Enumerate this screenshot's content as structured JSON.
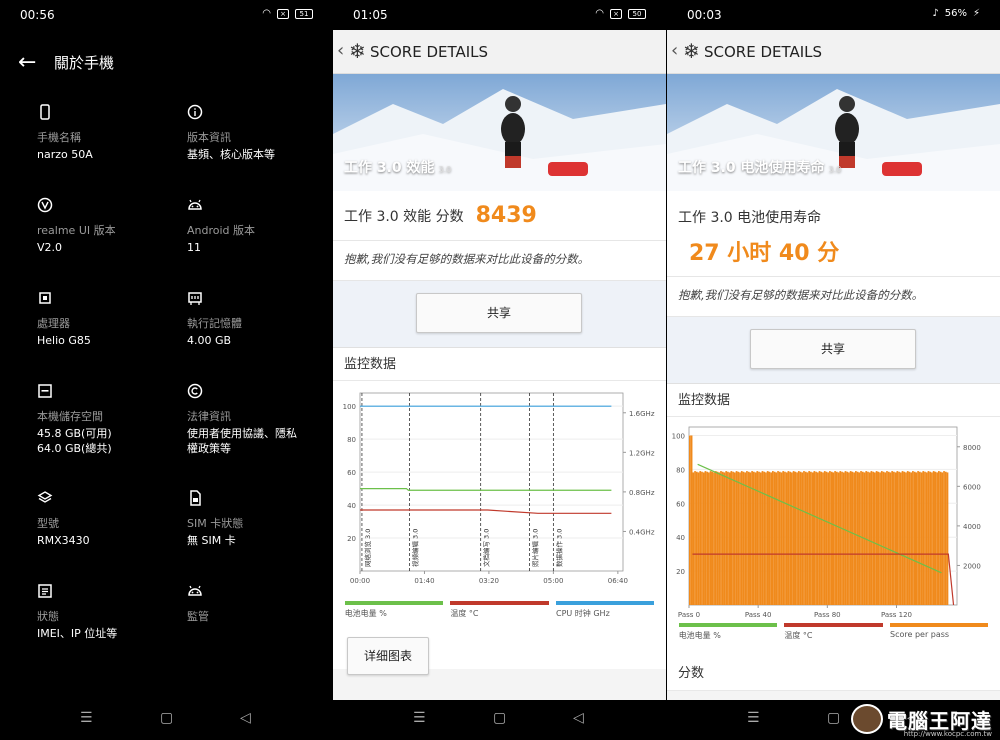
{
  "panel1": {
    "status": {
      "time": "00:56",
      "battery": "51"
    },
    "title": "關於手機",
    "items": [
      {
        "icon": "phone-icon",
        "label": "手機名稱",
        "value": "narzo 50A"
      },
      {
        "icon": "info-icon",
        "label": "版本資訊",
        "value": "基頻、核心版本等"
      },
      {
        "icon": "realme-ui-icon",
        "label": "realme UI 版本",
        "value": "V2.0"
      },
      {
        "icon": "android-icon",
        "label": "Android 版本",
        "value": "11"
      },
      {
        "icon": "processor-icon",
        "label": "處理器",
        "value": "Helio G85"
      },
      {
        "icon": "memory-icon",
        "label": "執行記憶體",
        "value": "4.00 GB"
      },
      {
        "icon": "storage-icon",
        "label": "本機儲存空間",
        "value": "45.8 GB(可用)\n64.0 GB(總共)"
      },
      {
        "icon": "copyright-icon",
        "label": "法律資訊",
        "value": "使用者使用協議、隱私\n權政策等"
      },
      {
        "icon": "layers-icon",
        "label": "型號",
        "value": "RMX3430"
      },
      {
        "icon": "sim-icon",
        "label": "SIM 卡狀態",
        "value": "無 SIM 卡"
      },
      {
        "icon": "document-icon",
        "label": "狀態",
        "value": "IMEI、IP 位址等"
      },
      {
        "icon": "android-icon",
        "label": "監管",
        "value": ""
      }
    ]
  },
  "panel2": {
    "status": {
      "time": "01:05",
      "battery": "50"
    },
    "header": "SCORE DETAILS",
    "banner_title": "工作 3.0 效能",
    "banner_version": "3.0",
    "score_label": "工作 3.0 效能 分数",
    "score_value": "8439",
    "note": "抱歉,我们没有足够的数据来对比此设备的分数。",
    "share": "共享",
    "monitor_title": "监控数据",
    "legend": [
      "电池电量 %",
      "温度 °C",
      "CPU 时钟 GHz"
    ],
    "detail_button": "详细图表"
  },
  "panel3": {
    "status": {
      "time": "00:03",
      "battery": "56%"
    },
    "header": "SCORE DETAILS",
    "banner_title": "工作 3.0 电池使用寿命",
    "banner_version": "3.0",
    "score_label": "工作 3.0 电池使用寿命",
    "score_value": "27 小时 40 分",
    "note": "抱歉,我们没有足够的数据来对比此设备的分数。",
    "share": "共享",
    "monitor_title": "监控数据",
    "legend": [
      "电池电量 %",
      "温度 °C",
      "Score per pass"
    ],
    "section_after": "分数"
  },
  "watermark": {
    "text": "電腦王阿達",
    "url": "http://www.kocpc.com.tw"
  },
  "colors": {
    "orange": "#f08a1c",
    "green": "#6cc04a",
    "red": "#c0392b",
    "blue": "#3aa0dc"
  },
  "chart_data": [
    {
      "type": "line",
      "title": "监控数据",
      "x_ticks": [
        "00:00",
        "01:40",
        "03:20",
        "05:00",
        "06:40"
      ],
      "y_ticks_left": [
        20,
        40,
        60,
        80,
        100
      ],
      "y_ticks_right": [
        "0.4GHz",
        "0.8GHz",
        "1.2GHz",
        "1.6GHz"
      ],
      "ylim": [
        0,
        108
      ],
      "series": [
        {
          "name": "电池电量 %",
          "color": "#6cc04a",
          "x": [
            0,
            1.2,
            1.25,
            6.5
          ],
          "y": [
            50,
            50,
            49,
            49
          ]
        },
        {
          "name": "温度 °C",
          "color": "#c0392b",
          "x": [
            0,
            1.2,
            3.3,
            4.6,
            6.5
          ],
          "y": [
            37,
            37,
            37,
            35,
            35
          ]
        },
        {
          "name": "CPU 时钟 GHz",
          "color": "#3aa0dc",
          "x": [
            0,
            6.5
          ],
          "y": [
            100,
            100
          ]
        }
      ],
      "annotations": [
        "网络浏览 3.0",
        "视频编辑 3.0",
        "文档编写 3.0",
        "照片编辑 3.0",
        "数据操作 3.0"
      ]
    },
    {
      "type": "bar",
      "title": "监控数据",
      "x_ticks": [
        "Pass 0",
        "Pass 40",
        "Pass 80",
        "Pass 120"
      ],
      "y_ticks_left": [
        20,
        40,
        60,
        80,
        100
      ],
      "y_ticks_right": [
        2000,
        4000,
        6000,
        8000
      ],
      "ylim": [
        0,
        105
      ],
      "series": [
        {
          "name": "Score per pass",
          "color": "#f08a1c",
          "x": [
            0,
            2,
            2.5,
            150
          ],
          "y": [
            100,
            100,
            79,
            79
          ]
        },
        {
          "name": "电池电量 %",
          "color": "#6cc04a",
          "x": [
            5,
            146
          ],
          "y": [
            83,
            19
          ]
        },
        {
          "name": "温度 °C",
          "color": "#c0392b",
          "x": [
            2,
            150,
            153
          ],
          "y": [
            30,
            30,
            0
          ]
        }
      ]
    }
  ]
}
